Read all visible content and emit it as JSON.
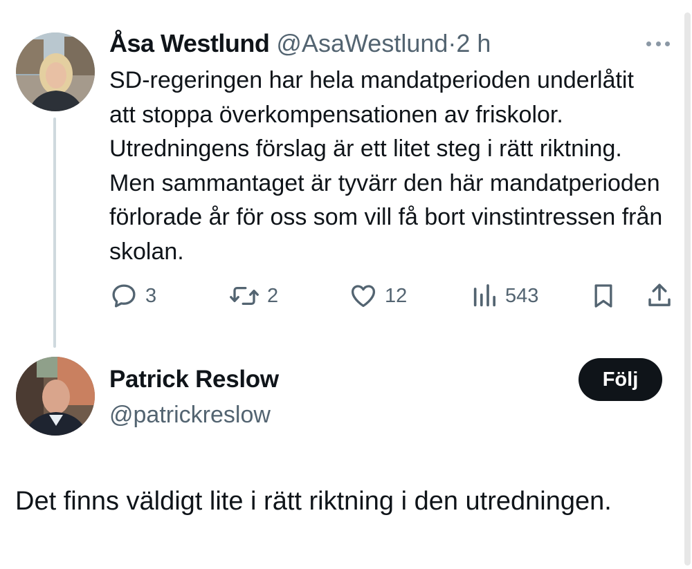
{
  "parent_tweet": {
    "author_name": "Åsa Westlund",
    "author_handle": "@AsaWestlund",
    "separator": "·",
    "time_ago": "2 h",
    "avatar_icon": "profile-photo-woman",
    "more_icon": "more-horizontal-icon",
    "text": "SD-regeringen har hela mandatperioden underlåtit att stoppa överkompensationen av friskolor. Utredningens förslag är ett litet steg i rätt riktning. Men sammantaget är tyvärr den här mandatperioden förlorade år för oss som vill få bort vinstintressen från skolan.",
    "stats": {
      "replies": "3",
      "reposts": "2",
      "likes": "12",
      "views": "543"
    }
  },
  "reply_tweet": {
    "author_name": "Patrick Reslow",
    "author_handle": "@patrickreslow",
    "avatar_icon": "profile-photo-man",
    "follow_label": "Följ",
    "text": "Det finns väldigt lite i rätt riktning i den utredningen."
  },
  "colors": {
    "text_primary": "#0f1419",
    "text_secondary": "#536471",
    "thread_line": "#cfd9de",
    "follow_bg": "#0f1419"
  }
}
